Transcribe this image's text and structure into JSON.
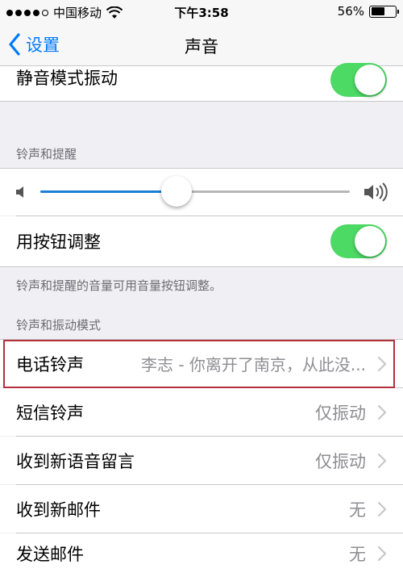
{
  "status_bar": {
    "carrier": "中国移动",
    "time": "下午3:58",
    "battery_percent": "56%",
    "battery_level": 0.56,
    "signal_bars_filled": 4,
    "signal_bars_total": 5
  },
  "nav": {
    "back_label": "设置",
    "title": "声音"
  },
  "vibrate_on_silent": {
    "label": "静音模式振动",
    "on": true
  },
  "ringer_section": {
    "header": "铃声和提醒",
    "volume_level": 0.44,
    "change_with_buttons_label": "用按钮调整",
    "change_with_buttons_on": true,
    "footer": "铃声和提醒的音量可用音量按钮调整。"
  },
  "sounds_section": {
    "header": "铃声和振动模式",
    "items": [
      {
        "label": "电话铃声",
        "value": "李志 - 你离开了南京，从此没..."
      },
      {
        "label": "短信铃声",
        "value": "仅振动"
      },
      {
        "label": "收到新语音留言",
        "value": "仅振动"
      },
      {
        "label": "收到新邮件",
        "value": "无"
      },
      {
        "label": "发送邮件",
        "value": "无"
      }
    ]
  },
  "colors": {
    "accent": "#007aff",
    "toggle_on": "#4cd964",
    "highlight_border": "#b2313a"
  }
}
